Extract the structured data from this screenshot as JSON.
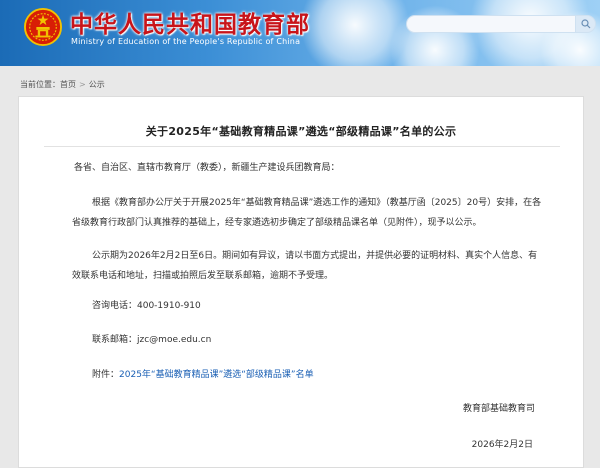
{
  "header": {
    "site_title": "中华人民共和国教育部",
    "site_subtitle": "Ministry of Education of the People's Republic of China",
    "search_placeholder": ""
  },
  "breadcrumb": {
    "prefix": "当前位置：",
    "home": "首页",
    "separator": ">",
    "current": "公示"
  },
  "article": {
    "title": "关于2025年“基础教育精品课”遴选“部级精品课”名单的公示",
    "salutation": "各省、自治区、直辖市教育厅（教委），新疆生产建设兵团教育局：",
    "paragraph1": "根据《教育部办公厅关于开展2025年“基础教育精品课”遴选工作的通知》（教基厅函〔2025〕20号）安排，在各省级教育行政部门认真推荐的基础上，经专家遴选初步确定了部级精品课名单（见附件），现予以公示。",
    "paragraph2": "公示期为2026年2月2日至6日。期间如有异议，请以书面方式提出，并提供必要的证明材料、真实个人信息、有效联系电话和地址，扫描或拍照后发至联系邮箱，逾期不予受理。",
    "phone_line": "咨询电话：400-1910-910",
    "email_line": "联系邮箱：jzc@moe.edu.cn",
    "attachment_label": "附件：",
    "attachment_link": "2025年“基础教育精品课”遴选“部级精品课”名单",
    "signature_org": "教育部基础教育司",
    "signature_date": "2026年2月2日"
  },
  "colors": {
    "title_red": "#c8141a",
    "header_blue": "#1b6bb6",
    "link_blue": "#1a5fb4"
  }
}
